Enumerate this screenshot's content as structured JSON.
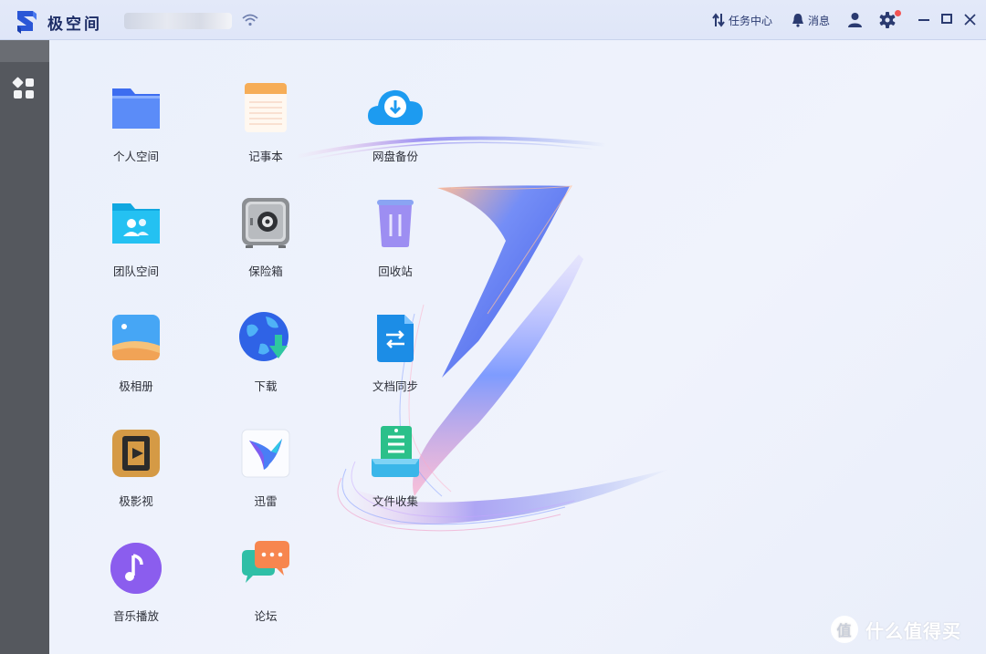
{
  "window": {
    "app_name": "极空间",
    "device_name": "",
    "task_center_label": "任务中心",
    "messages_label": "消息",
    "icons": {
      "logo": "zspace-logo",
      "wifi": "wifi-icon",
      "task_center": "transfer-arrows-icon",
      "messages": "bell-icon",
      "user": "user-icon",
      "settings": "gear-icon",
      "minimize": "minimize-icon",
      "maximize": "maximize-icon",
      "close": "close-icon"
    },
    "accent_color": "#2a56d6",
    "notification_dot_color": "#f35454"
  },
  "sidebar": {
    "items": [
      {
        "name": "apps-grid-icon"
      }
    ]
  },
  "apps": [
    {
      "label": "个人空间",
      "icon": "folder-icon"
    },
    {
      "label": "记事本",
      "icon": "notepad-icon"
    },
    {
      "label": "网盘备份",
      "icon": "cloud-download-icon"
    },
    {
      "label": "团队空间",
      "icon": "team-folder-icon"
    },
    {
      "label": "保险箱",
      "icon": "safe-icon"
    },
    {
      "label": "回收站",
      "icon": "trash-icon"
    },
    {
      "label": "极相册",
      "icon": "photo-album-icon"
    },
    {
      "label": "下载",
      "icon": "globe-download-icon"
    },
    {
      "label": "文档同步",
      "icon": "document-sync-icon"
    },
    {
      "label": "极影视",
      "icon": "video-icon"
    },
    {
      "label": "迅雷",
      "icon": "thunder-bird-icon"
    },
    {
      "label": "文件收集",
      "icon": "file-collect-icon"
    },
    {
      "label": "音乐播放",
      "icon": "music-icon"
    },
    {
      "label": "论坛",
      "icon": "forum-chat-icon"
    }
  ],
  "watermark": {
    "glyph": "值",
    "text": "什么值得买"
  }
}
